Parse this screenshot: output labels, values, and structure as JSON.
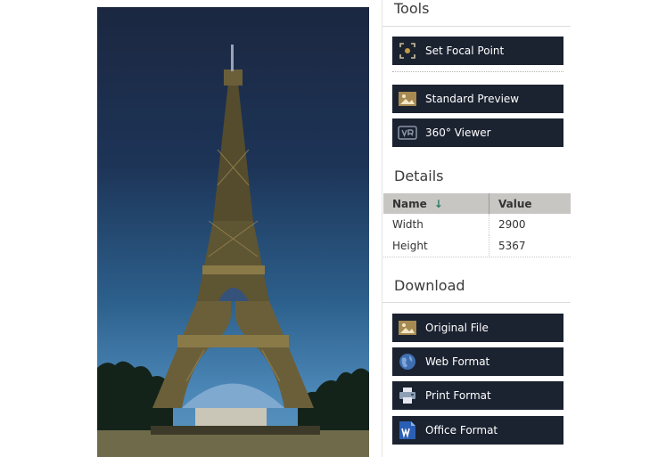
{
  "tools": {
    "title": "Tools",
    "buttons": [
      {
        "label": "Set Focal Point",
        "icon": "focal-point-icon"
      },
      {
        "label": "Standard Preview",
        "icon": "image-icon"
      },
      {
        "label": "360° Viewer",
        "icon": "vr-icon"
      }
    ]
  },
  "details": {
    "title": "Details",
    "columns": [
      "Name",
      "Value"
    ],
    "sort_icon": "sort-down-arrow-icon",
    "rows": [
      {
        "name": "Width",
        "value": "2900"
      },
      {
        "name": "Height",
        "value": "5367"
      }
    ]
  },
  "download": {
    "title": "Download",
    "buttons": [
      {
        "label": "Original File",
        "icon": "image-icon"
      },
      {
        "label": "Web Format",
        "icon": "globe-icon"
      },
      {
        "label": "Print Format",
        "icon": "printer-icon"
      },
      {
        "label": "Office Format",
        "icon": "word-document-icon"
      }
    ]
  },
  "colors": {
    "button_bg": "#1b2230",
    "button_text": "#ffffff",
    "table_header_bg": "#c8c6c3",
    "sort_arrow": "#2f7a6a"
  },
  "preview_image": {
    "subject": "Eiffel Tower at dusk",
    "icon": "photo-preview"
  }
}
